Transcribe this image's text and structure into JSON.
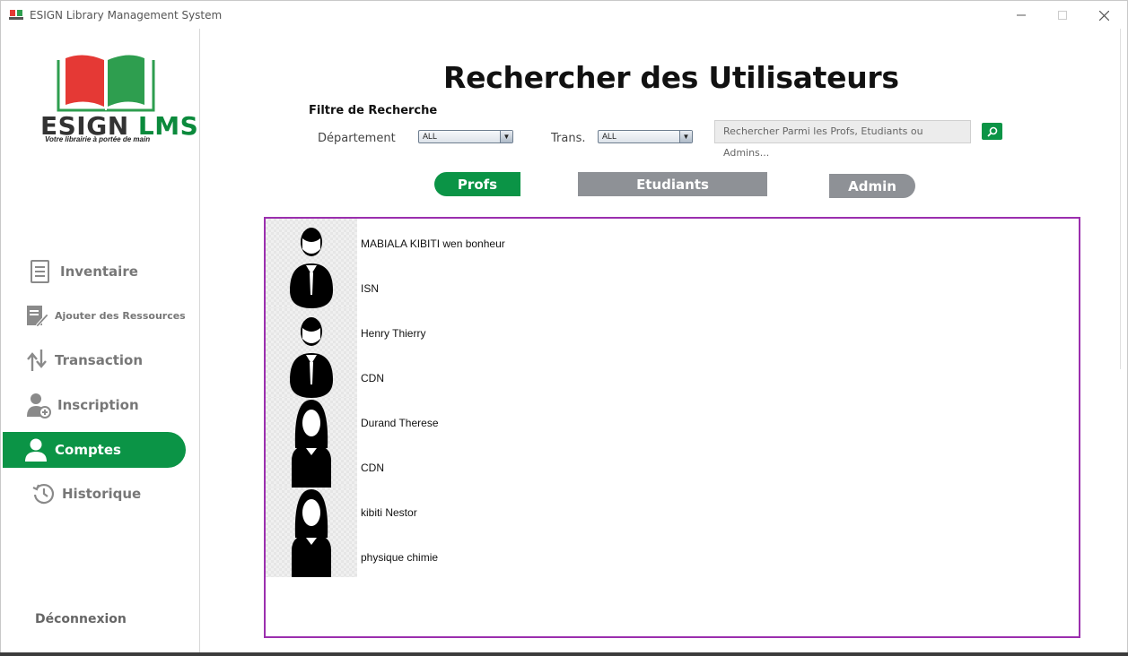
{
  "window": {
    "title": "ESIGN Library Management System"
  },
  "logo": {
    "brand_esign": "ESIGN",
    "brand_lms": "LMS",
    "tagline": "Votre librairie à portée de main"
  },
  "sidebar": {
    "items": [
      {
        "label": "Inventaire",
        "icon": "document-icon"
      },
      {
        "label": "Ajouter des Ressources",
        "icon": "edit-document-icon"
      },
      {
        "label": "Transaction",
        "icon": "transfer-arrows-icon"
      },
      {
        "label": "Inscription",
        "icon": "add-user-icon"
      },
      {
        "label": "Comptes",
        "icon": "user-icon",
        "active": true
      },
      {
        "label": "Historique",
        "icon": "history-icon"
      }
    ],
    "logout_label": "Déconnexion"
  },
  "main": {
    "title": "Rechercher des Utilisateurs",
    "filter_title": "Filtre de Recherche",
    "department_label": "Département",
    "department_value": "ALL",
    "trans_label": "Trans.",
    "trans_value": "ALL",
    "search_placeholder": "Rechercher  Parmi les Profs, Etudiants ou Admins..."
  },
  "tabs": {
    "profs": "Profs",
    "etudiants": "Etudiants",
    "admin": "Admin"
  },
  "results": [
    {
      "name": "MABIALA KIBITI wen bonheur",
      "department": "ISN",
      "avatar": "male-avatar-icon"
    },
    {
      "name": "Henry Thierry",
      "department": "CDN",
      "avatar": "male-avatar-icon"
    },
    {
      "name": "Durand Therese",
      "department": "CDN",
      "avatar": "female-avatar-icon"
    },
    {
      "name": "kibiti Nestor",
      "department": "physique chimie",
      "avatar": "female-avatar-icon"
    }
  ],
  "colors": {
    "accent_green": "#0b9446",
    "tab_gray": "#8e9196",
    "results_border": "#9b2fae"
  }
}
